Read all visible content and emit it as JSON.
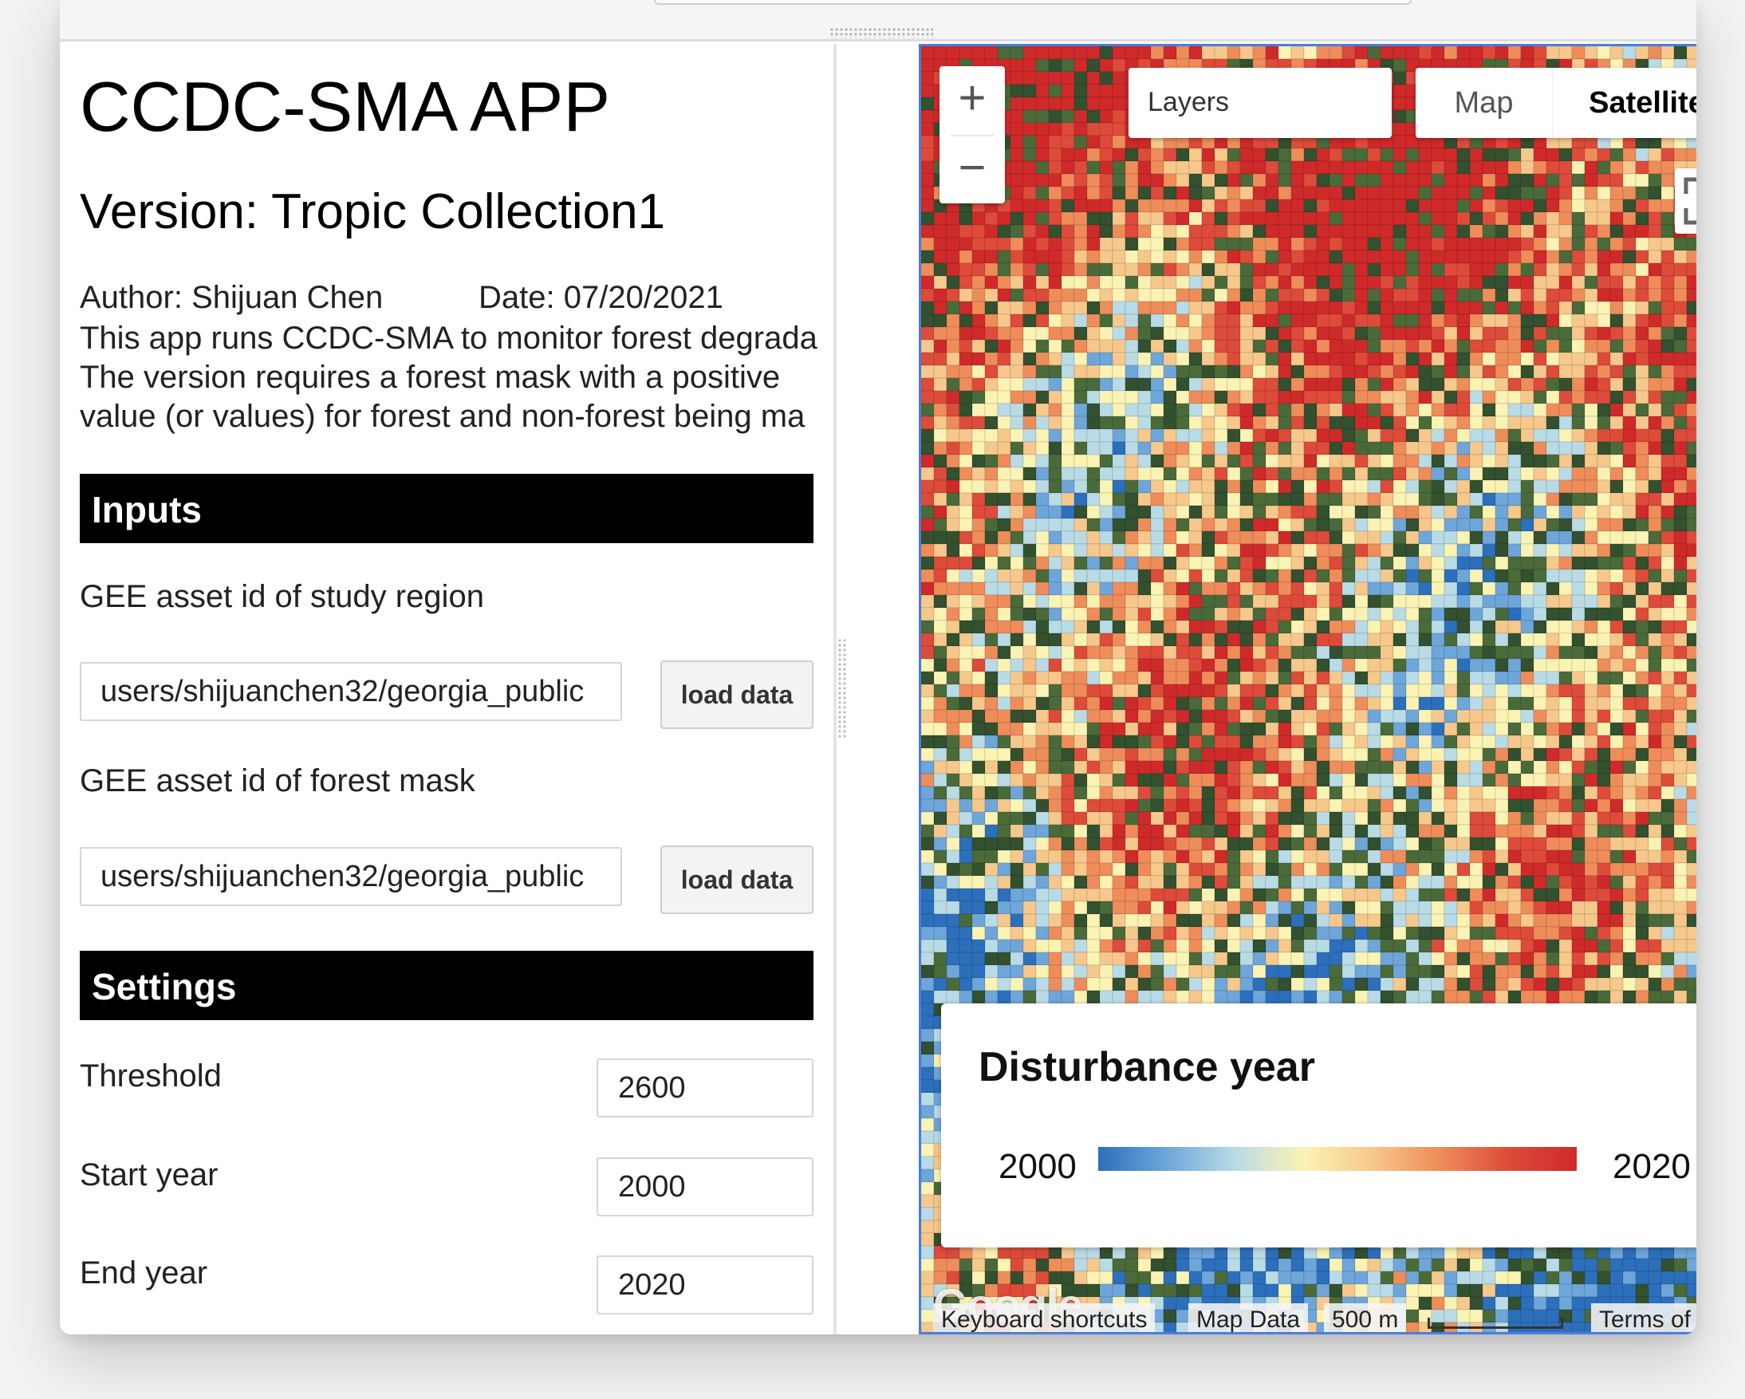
{
  "app": {
    "title": "CCDC-SMA APP",
    "version": "Version: Tropic Collection1",
    "author": "Author: Shijuan Chen",
    "date": "Date: 07/20/2021",
    "description": [
      "This app runs CCDC-SMA to monitor forest degrada",
      "The version requires a forest mask with a positive",
      "value (or values) for forest and non-forest being ma"
    ]
  },
  "inputs": {
    "header": "Inputs",
    "region_label": "GEE asset id of study region",
    "region_value": "users/shijuanchen32/georgia_public",
    "region_button": "load data",
    "mask_label": "GEE asset id of forest mask",
    "mask_value": "users/shijuanchen32/georgia_public",
    "mask_button": "load data"
  },
  "settings": {
    "header": "Settings",
    "threshold_label": "Threshold",
    "threshold_value": "2600",
    "start_label": "Start year",
    "start_value": "2000",
    "end_label": "End year",
    "end_value": "2020"
  },
  "map": {
    "zoom_in": "+",
    "zoom_out": "−",
    "layers_label": "Layers",
    "type_map": "Map",
    "type_satellite": "Satellite",
    "selected_type": "Satellite",
    "legend": {
      "title": "Disturbance year",
      "min": "2000",
      "max": "2020",
      "palette": [
        "#2c6fbb",
        "#6ea6d9",
        "#b9dbe6",
        "#fbf3b4",
        "#f7c88c",
        "#ee8d5a",
        "#dd4b3a",
        "#cf2a2a"
      ]
    },
    "google_logo": "Google",
    "keyboard_shortcuts": "Keyboard shortcuts",
    "map_data": "Map Data",
    "scale_label": "500 m",
    "terms": "Terms of Use"
  }
}
